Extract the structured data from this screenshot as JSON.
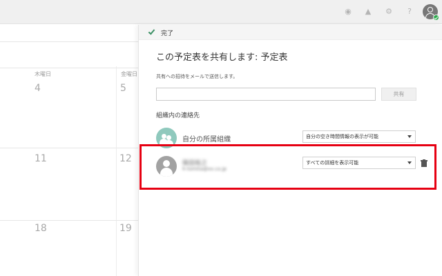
{
  "calendar": {
    "weekdays": [
      "木曜日",
      "金曜日"
    ],
    "days": [
      "4",
      "5",
      "11",
      "12",
      "18",
      "19"
    ]
  },
  "share_panel": {
    "done_label": "完了",
    "title": "この予定表を共有します: 予定表",
    "instruction": "共有への招待をメールで送信します。",
    "email_input": {
      "value": "",
      "placeholder": ""
    },
    "share_button_label": "共有",
    "section_title": "組織内の連絡先",
    "org_contact": {
      "name": "自分の所属組織",
      "permission": "自分の空き時間情報の表示が可能"
    },
    "user_contact": {
      "name": "篠田祐之",
      "email": "h-tomita@xx.co.jp",
      "permission": "すべての詳細を表示可能"
    }
  },
  "colors": {
    "highlight": "#e60012",
    "check": "#3a8f63",
    "org_avatar": "#8fc9bd",
    "user_avatar": "#a2a2a2",
    "presence": "#2aa84a"
  }
}
